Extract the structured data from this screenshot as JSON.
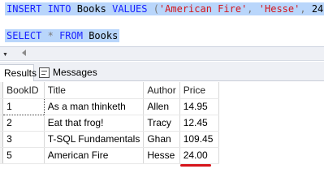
{
  "editor": {
    "line1": {
      "kw1": "INSERT",
      "kw2": "INTO",
      "table": "Books",
      "kw3": "VALUES",
      "paren_open": "(",
      "str1": "'American Fire'",
      "comma1": ",",
      "str2": "'Hesse'",
      "comma2": ",",
      "num": "24",
      "paren_close": ")"
    },
    "line3": {
      "kw1": "SELECT",
      "star": "*",
      "kw2": "FROM",
      "table": "Books"
    }
  },
  "tabs": {
    "results": "Results",
    "messages": "Messages"
  },
  "grid": {
    "headers": [
      "BookID",
      "Title",
      "Author",
      "Price"
    ],
    "rows": [
      {
        "id": "1",
        "title": "As a man thinketh",
        "author": "Allen",
        "price": "14.95"
      },
      {
        "id": "2",
        "title": "Eat that frog!",
        "author": "Tracy",
        "price": "12.45"
      },
      {
        "id": "3",
        "title": "T-SQL Fundamentals",
        "author": "Ghan",
        "price": "109.45"
      },
      {
        "id": "5",
        "title": "American Fire",
        "author": "Hesse",
        "price": "24.00"
      }
    ]
  },
  "colors": {
    "selection": "#b9d6fb",
    "keyword": "#1a22ff",
    "string": "#d4151b",
    "highlight_underline": "#d6141a"
  }
}
